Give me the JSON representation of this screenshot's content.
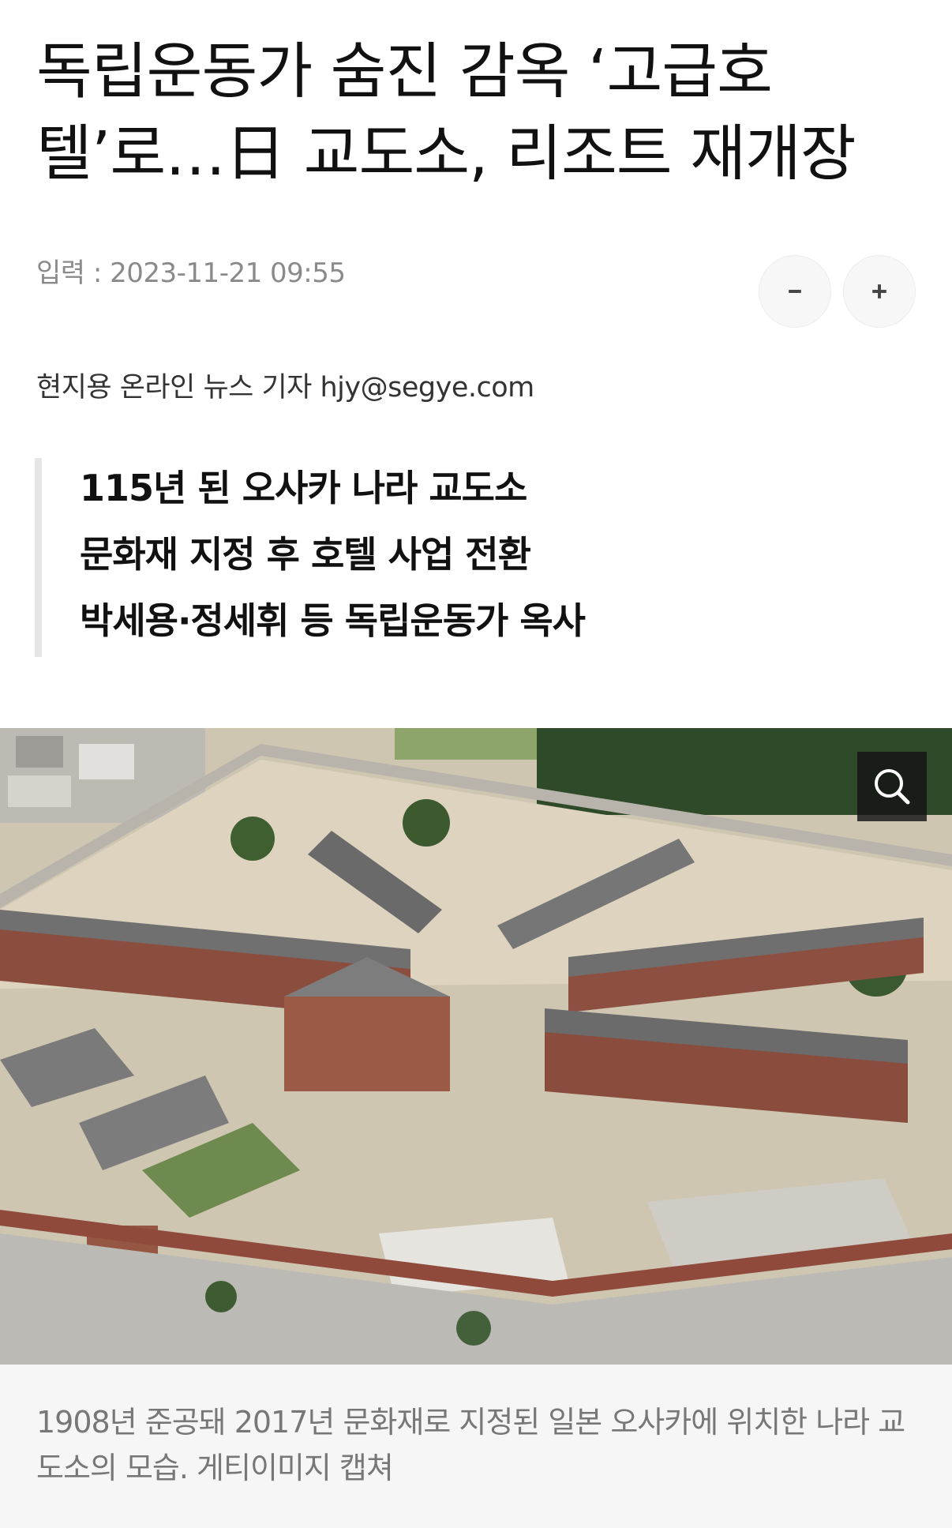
{
  "article": {
    "headline_line1": "독립운동가 숨진 감옥 ‘고급호",
    "headline_line2": "텔’로…日 교도소, 리조트 재개장",
    "date_label": "입력 : 2023-11-21 09:55",
    "byline": "현지용 온라인 뉴스 기자 hjy@segye.com",
    "summary": [
      "115년 된 오사카 나라 교도소",
      "문화재 지정 후 호텔 사업 전환",
      "박세용·정세휘 등 독립운동가 옥사"
    ],
    "caption": "1908년 준공돼 2017년 문화재로 지정된 일본 오사카에 위치한 나라 교도소의 모습. 게티이미지 캡쳐"
  },
  "controls": {
    "font_decrease_icon": "minus-icon",
    "font_increase_icon": "plus-icon",
    "zoom_icon": "search-icon"
  },
  "colors": {
    "brick": "#8a4a3a",
    "roof": "#6e6e6e",
    "ground": "#d8d0bf",
    "trees": "#2f4f2a"
  }
}
